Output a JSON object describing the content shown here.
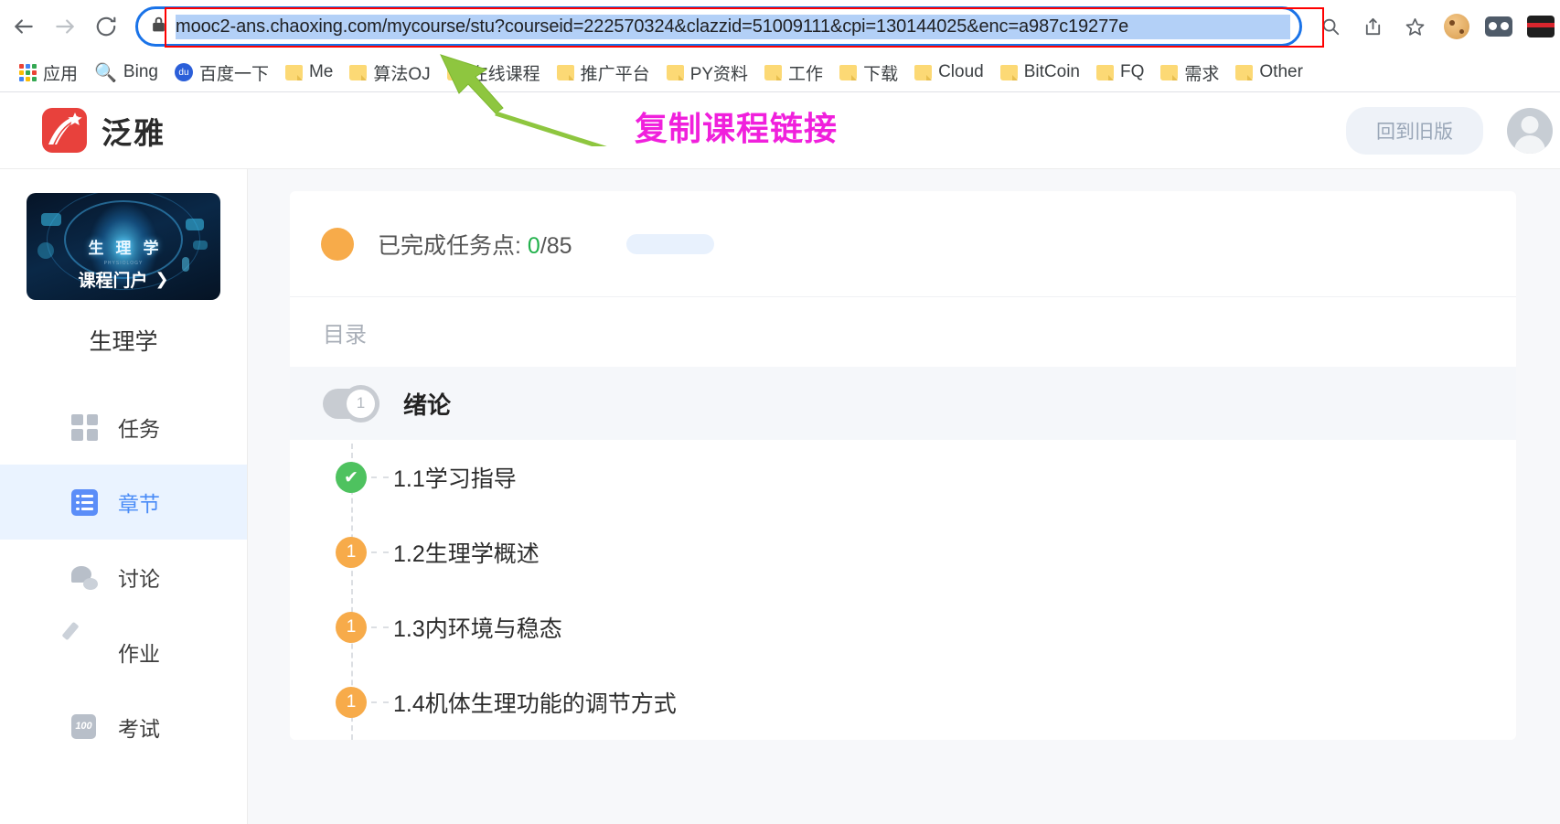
{
  "browser": {
    "back_icon": "back-arrow-icon",
    "forward_icon": "forward-arrow-icon",
    "reload_icon": "reload-icon",
    "lock_icon": "lock-icon",
    "url": "mooc2-ans.chaoxing.com/mycourse/stu?courseid=222570324&clazzid=51009111&cpi=130144025&enc=a987c19277e",
    "zoom_icon": "zoom-search-icon",
    "share_icon": "share-icon",
    "bookmark_star_icon": "star-icon",
    "highlight_color": "#ff0000",
    "selection_color": "#b3d0f7",
    "omnibox_border_color": "#1a73e8"
  },
  "bookmarks": [
    {
      "label": "应用",
      "icon": "apps-grid-icon"
    },
    {
      "label": "Bing",
      "icon": "bing-search-icon"
    },
    {
      "label": "百度一下",
      "icon": "baidu-icon"
    },
    {
      "label": "Me",
      "icon": "folder-icon"
    },
    {
      "label": "算法OJ",
      "icon": "folder-icon"
    },
    {
      "label": "在线课程",
      "icon": "folder-icon"
    },
    {
      "label": "推广平台",
      "icon": "folder-icon"
    },
    {
      "label": "PY资料",
      "icon": "folder-icon"
    },
    {
      "label": "工作",
      "icon": "folder-icon"
    },
    {
      "label": "下载",
      "icon": "folder-icon"
    },
    {
      "label": "Cloud",
      "icon": "folder-icon"
    },
    {
      "label": "BitCoin",
      "icon": "folder-icon"
    },
    {
      "label": "FQ",
      "icon": "folder-icon"
    },
    {
      "label": "需求",
      "icon": "folder-icon"
    },
    {
      "label": "Other",
      "icon": "folder-icon"
    }
  ],
  "annotation": {
    "text": "复制课程链接",
    "text_color": "#f020dc",
    "arrow_color": "#8ec63f"
  },
  "site_header": {
    "logo_text": "泛雅",
    "logo_color": "#e8413c",
    "old_version_button": "回到旧版",
    "avatar_icon": "user-avatar-icon"
  },
  "sidebar": {
    "course_card": {
      "cover_title": "生理学",
      "cover_subtitle": "PHYSIOLOGY",
      "portal_label": "课程门户",
      "portal_chevron": "chevron-right-icon"
    },
    "course_name": "生理学",
    "items": [
      {
        "label": "任务",
        "icon": "grid-icon",
        "active": false
      },
      {
        "label": "章节",
        "icon": "list-icon",
        "active": true
      },
      {
        "label": "讨论",
        "icon": "chat-icon",
        "active": false
      },
      {
        "label": "作业",
        "icon": "document-pencil-icon",
        "active": false
      },
      {
        "label": "考试",
        "icon": "score-100-icon",
        "active": false
      }
    ],
    "active_color": "#4b8cf7"
  },
  "main": {
    "progress": {
      "status_icon": "orange-circle-icon",
      "label": "已完成任务点: ",
      "completed": "0",
      "total": "/85",
      "completed_color": "#22b14c"
    },
    "catalog_label": "目录",
    "chapter": {
      "number": "1",
      "title": "绪论"
    },
    "sections": [
      {
        "badge": "✔",
        "state": "done",
        "title": "1.1学习指导"
      },
      {
        "badge": "1",
        "state": "pending",
        "title": "1.2生理学概述"
      },
      {
        "badge": "1",
        "state": "pending",
        "title": "1.3内环境与稳态"
      },
      {
        "badge": "1",
        "state": "pending",
        "title": "1.4机体生理功能的调节方式"
      }
    ]
  }
}
